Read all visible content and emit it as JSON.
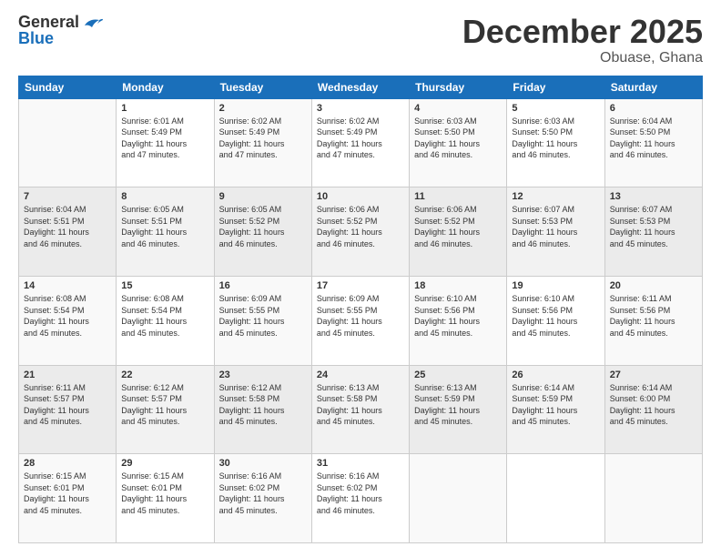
{
  "header": {
    "logo_general": "General",
    "logo_blue": "Blue",
    "title": "December 2025",
    "location": "Obuase, Ghana"
  },
  "calendar": {
    "days_of_week": [
      "Sunday",
      "Monday",
      "Tuesday",
      "Wednesday",
      "Thursday",
      "Friday",
      "Saturday"
    ],
    "weeks": [
      [
        {
          "day": "",
          "info": ""
        },
        {
          "day": "1",
          "info": "Sunrise: 6:01 AM\nSunset: 5:49 PM\nDaylight: 11 hours\nand 47 minutes."
        },
        {
          "day": "2",
          "info": "Sunrise: 6:02 AM\nSunset: 5:49 PM\nDaylight: 11 hours\nand 47 minutes."
        },
        {
          "day": "3",
          "info": "Sunrise: 6:02 AM\nSunset: 5:49 PM\nDaylight: 11 hours\nand 47 minutes."
        },
        {
          "day": "4",
          "info": "Sunrise: 6:03 AM\nSunset: 5:50 PM\nDaylight: 11 hours\nand 46 minutes."
        },
        {
          "day": "5",
          "info": "Sunrise: 6:03 AM\nSunset: 5:50 PM\nDaylight: 11 hours\nand 46 minutes."
        },
        {
          "day": "6",
          "info": "Sunrise: 6:04 AM\nSunset: 5:50 PM\nDaylight: 11 hours\nand 46 minutes."
        }
      ],
      [
        {
          "day": "7",
          "info": "Sunrise: 6:04 AM\nSunset: 5:51 PM\nDaylight: 11 hours\nand 46 minutes."
        },
        {
          "day": "8",
          "info": "Sunrise: 6:05 AM\nSunset: 5:51 PM\nDaylight: 11 hours\nand 46 minutes."
        },
        {
          "day": "9",
          "info": "Sunrise: 6:05 AM\nSunset: 5:52 PM\nDaylight: 11 hours\nand 46 minutes."
        },
        {
          "day": "10",
          "info": "Sunrise: 6:06 AM\nSunset: 5:52 PM\nDaylight: 11 hours\nand 46 minutes."
        },
        {
          "day": "11",
          "info": "Sunrise: 6:06 AM\nSunset: 5:52 PM\nDaylight: 11 hours\nand 46 minutes."
        },
        {
          "day": "12",
          "info": "Sunrise: 6:07 AM\nSunset: 5:53 PM\nDaylight: 11 hours\nand 46 minutes."
        },
        {
          "day": "13",
          "info": "Sunrise: 6:07 AM\nSunset: 5:53 PM\nDaylight: 11 hours\nand 45 minutes."
        }
      ],
      [
        {
          "day": "14",
          "info": "Sunrise: 6:08 AM\nSunset: 5:54 PM\nDaylight: 11 hours\nand 45 minutes."
        },
        {
          "day": "15",
          "info": "Sunrise: 6:08 AM\nSunset: 5:54 PM\nDaylight: 11 hours\nand 45 minutes."
        },
        {
          "day": "16",
          "info": "Sunrise: 6:09 AM\nSunset: 5:55 PM\nDaylight: 11 hours\nand 45 minutes."
        },
        {
          "day": "17",
          "info": "Sunrise: 6:09 AM\nSunset: 5:55 PM\nDaylight: 11 hours\nand 45 minutes."
        },
        {
          "day": "18",
          "info": "Sunrise: 6:10 AM\nSunset: 5:56 PM\nDaylight: 11 hours\nand 45 minutes."
        },
        {
          "day": "19",
          "info": "Sunrise: 6:10 AM\nSunset: 5:56 PM\nDaylight: 11 hours\nand 45 minutes."
        },
        {
          "day": "20",
          "info": "Sunrise: 6:11 AM\nSunset: 5:56 PM\nDaylight: 11 hours\nand 45 minutes."
        }
      ],
      [
        {
          "day": "21",
          "info": "Sunrise: 6:11 AM\nSunset: 5:57 PM\nDaylight: 11 hours\nand 45 minutes."
        },
        {
          "day": "22",
          "info": "Sunrise: 6:12 AM\nSunset: 5:57 PM\nDaylight: 11 hours\nand 45 minutes."
        },
        {
          "day": "23",
          "info": "Sunrise: 6:12 AM\nSunset: 5:58 PM\nDaylight: 11 hours\nand 45 minutes."
        },
        {
          "day": "24",
          "info": "Sunrise: 6:13 AM\nSunset: 5:58 PM\nDaylight: 11 hours\nand 45 minutes."
        },
        {
          "day": "25",
          "info": "Sunrise: 6:13 AM\nSunset: 5:59 PM\nDaylight: 11 hours\nand 45 minutes."
        },
        {
          "day": "26",
          "info": "Sunrise: 6:14 AM\nSunset: 5:59 PM\nDaylight: 11 hours\nand 45 minutes."
        },
        {
          "day": "27",
          "info": "Sunrise: 6:14 AM\nSunset: 6:00 PM\nDaylight: 11 hours\nand 45 minutes."
        }
      ],
      [
        {
          "day": "28",
          "info": "Sunrise: 6:15 AM\nSunset: 6:01 PM\nDaylight: 11 hours\nand 45 minutes."
        },
        {
          "day": "29",
          "info": "Sunrise: 6:15 AM\nSunset: 6:01 PM\nDaylight: 11 hours\nand 45 minutes."
        },
        {
          "day": "30",
          "info": "Sunrise: 6:16 AM\nSunset: 6:02 PM\nDaylight: 11 hours\nand 45 minutes."
        },
        {
          "day": "31",
          "info": "Sunrise: 6:16 AM\nSunset: 6:02 PM\nDaylight: 11 hours\nand 46 minutes."
        },
        {
          "day": "",
          "info": ""
        },
        {
          "day": "",
          "info": ""
        },
        {
          "day": "",
          "info": ""
        }
      ]
    ]
  }
}
